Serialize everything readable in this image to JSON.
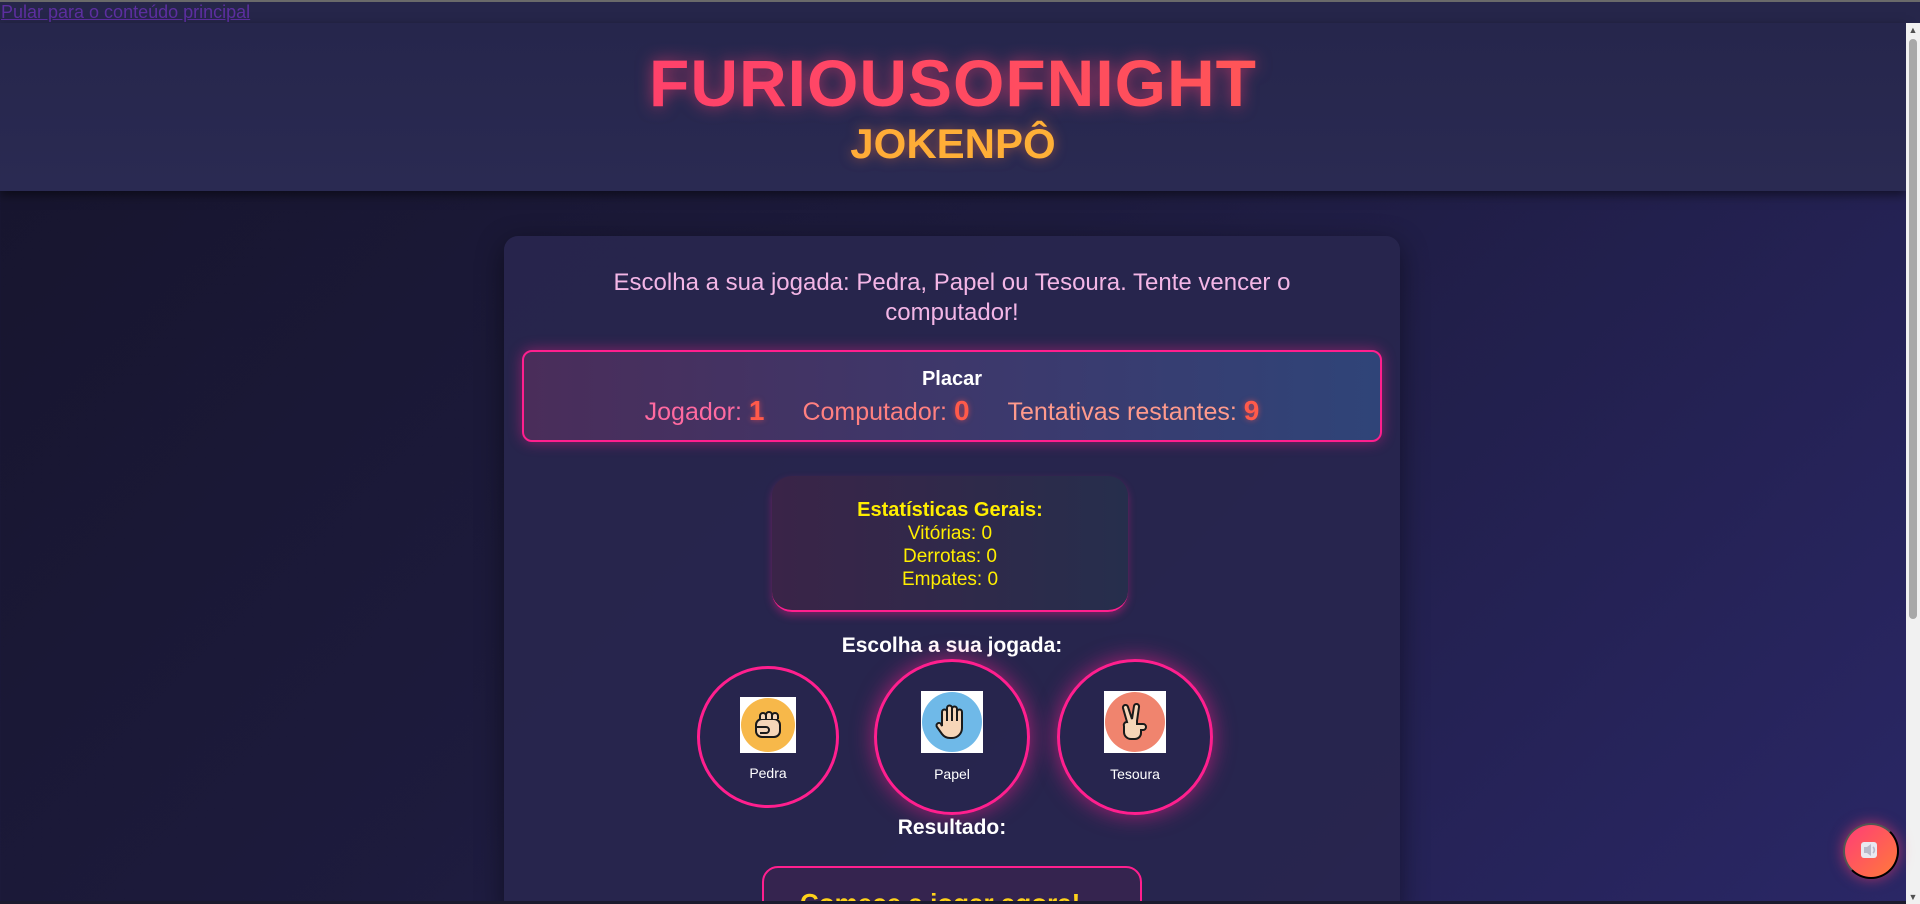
{
  "skip_link": "Pular para o conteúdo principal",
  "header": {
    "brand": "FURIOUSOFNIGHT",
    "subtitle": "JOKENPÔ"
  },
  "intro": "Escolha a sua jogada: Pedra, Papel ou Tesoura. Tente vencer o computador!",
  "scoreboard": {
    "title": "Placar",
    "player_label": "Jogador:",
    "player_score": "1",
    "computer_label": "Computador:",
    "computer_score": "0",
    "attempts_label": "Tentativas restantes:",
    "attempts_left": "9"
  },
  "stats": {
    "title": "Estatísticas Gerais:",
    "wins": "Vitórias: 0",
    "losses": "Derrotas: 0",
    "draws": "Empates: 0"
  },
  "choose_heading": "Escolha a sua jogada:",
  "choices": [
    {
      "label": "Pedra",
      "icon": "fist-icon"
    },
    {
      "label": "Papel",
      "icon": "open-hand-icon"
    },
    {
      "label": "Tesoura",
      "icon": "victory-hand-icon"
    }
  ],
  "result": {
    "heading": "Resultado:",
    "text": "Comece a jogar agora!"
  },
  "sound_button": {
    "icon": "speaker-icon"
  },
  "colors": {
    "accent_pink": "#ff1f8e",
    "brand_gradient_start": "#ff2f7e",
    "subtitle_orange": "#ff9a3a",
    "stats_yellow": "#ffee00",
    "score_red": "#ff5a4a"
  }
}
